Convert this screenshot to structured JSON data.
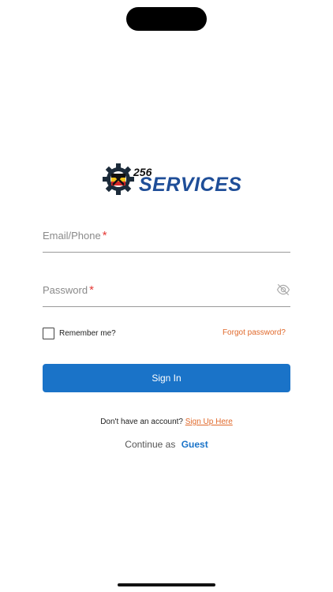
{
  "logo": {
    "number": "256",
    "wordmark": "SERVICES",
    "gear_icon": "gear-icon",
    "brand_color": "#1f4e98"
  },
  "form": {
    "email_label": "Email/Phone",
    "password_label": "Password",
    "required_mark": "*",
    "password_toggle_icon": "eye-off-icon",
    "remember_label": "Remember me?",
    "forgot_label": "Forgot password?",
    "signin_label": "Sign In"
  },
  "footer": {
    "signup_prompt": "Don't have an account?",
    "signup_link": "Sign Up Here",
    "continue_text": "Continue as",
    "guest_link": "Guest"
  },
  "colors": {
    "primary": "#1a73c8",
    "accent": "#e0692b",
    "required": "#e53935"
  }
}
